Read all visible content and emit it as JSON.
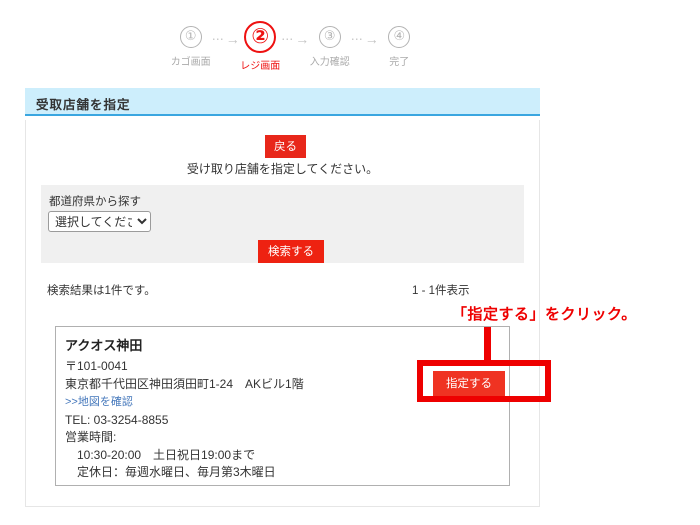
{
  "steps": {
    "items": [
      {
        "number": "①",
        "label": "カゴ画面",
        "active": false
      },
      {
        "number": "②",
        "label": "レジ画面",
        "active": true
      },
      {
        "number": "③",
        "label": "入力確認",
        "active": false
      },
      {
        "number": "④",
        "label": "完了",
        "active": false
      }
    ],
    "arrow_dots": "⋯",
    "arrow_head": "→"
  },
  "section": {
    "title": "受取店舗を指定",
    "header_bg": "#cdeefc",
    "header_border": "#3aa6e0"
  },
  "actions": {
    "back_label": "戻る",
    "search_label": "検索する",
    "designate_label": "指定する",
    "button_color": "#e8271a"
  },
  "lead_text": "受け取り店舗を指定してください。",
  "search_panel": {
    "label": "都道府県から探す",
    "select_value": "選択してください",
    "select_options": [
      "選択してください"
    ]
  },
  "results": {
    "count_text": "検索結果は1件です。",
    "range_text": "1 - 1件表示"
  },
  "store": {
    "name": "アクオス神田",
    "postal": "〒101-0041",
    "address": "東京都千代田区神田須田町1-24　AKビル1階",
    "map_link": ">>地図を確認",
    "tel": "TEL: 03-3254-8855",
    "hours_label": "営業時間:",
    "hours_value": "10:30-20:00　土日祝日19:00まで",
    "closed_days": "定休日：毎週水曜日、毎月第3木曜日"
  },
  "annotation": {
    "text": "「指定する」をクリック。",
    "color": "#ee0000"
  }
}
